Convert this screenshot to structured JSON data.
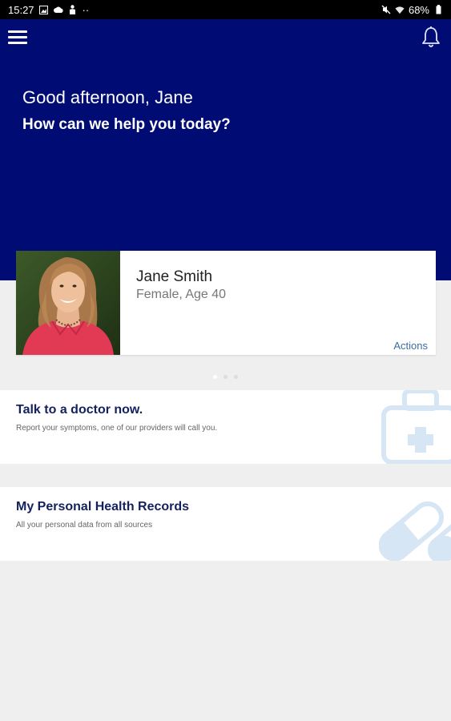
{
  "status_bar": {
    "time": "15:27",
    "battery": "68%",
    "dots": "··"
  },
  "header": {
    "greeting": "Good afternoon, Jane",
    "subtitle": "How can we help you today?",
    "background_color": "#000c73"
  },
  "profile": {
    "name": "Jane Smith",
    "details": "Female, Age 40",
    "actions_label": "Actions"
  },
  "carousel": {
    "count": 3,
    "active_index": 0
  },
  "cards": [
    {
      "title": "Talk to a doctor now.",
      "subtitle": "Report your symptoms, one of our providers will call you.",
      "icon": "medical-kit-icon"
    },
    {
      "title": "My Personal Health Records",
      "subtitle": "All your personal data from all sources",
      "icon": "pills-icon"
    }
  ],
  "colors": {
    "brand": "#000c73",
    "card_title": "#14215e",
    "link": "#3a6ea5",
    "icon_watermark": "#d6e6f5"
  }
}
